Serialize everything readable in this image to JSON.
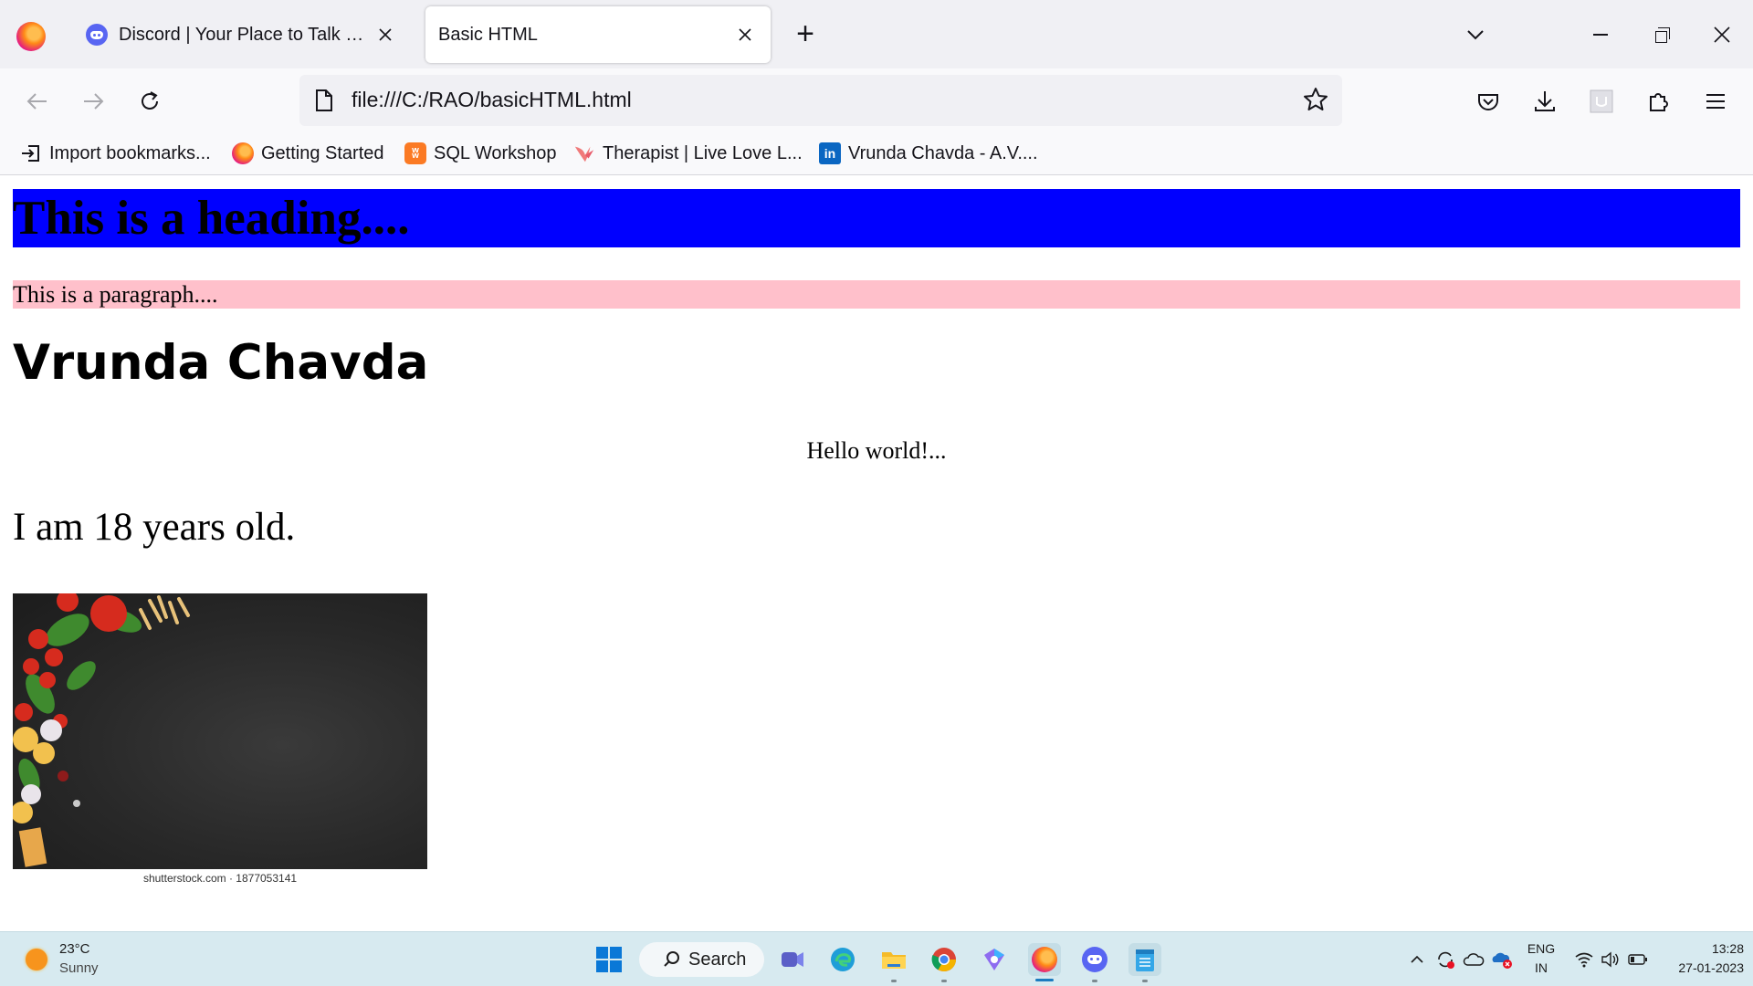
{
  "browser": {
    "tabs": [
      {
        "title": "Discord | Your Place to Talk and Hang Out",
        "active": false
      },
      {
        "title": "Basic HTML",
        "active": true
      }
    ],
    "url": "file:///C:/RAO/basicHTML.html"
  },
  "bookmarks": [
    {
      "label": "Import bookmarks...",
      "icon": "import-icon"
    },
    {
      "label": "Getting Started",
      "icon": "firefox-icon"
    },
    {
      "label": "SQL Workshop",
      "icon": "xampp-icon"
    },
    {
      "label": "Therapist | Live Love L...",
      "icon": "bird-icon"
    },
    {
      "label": "Vrunda Chavda - A.V....",
      "icon": "linkedin-icon"
    }
  ],
  "page": {
    "heading": "This is a heading....",
    "heading_bg": "#0000ff",
    "paragraph": "This is a paragraph....",
    "paragraph_bg": "#ffc0cb",
    "name": "Vrunda Chavda",
    "hello": "Hello world!...",
    "age_text": "I am 18 years old.",
    "image_caption": "shutterstock.com · 1877053141"
  },
  "taskbar": {
    "weather": {
      "temp": "23°C",
      "desc": "Sunny"
    },
    "search_label": "Search",
    "lang": {
      "line1": "ENG",
      "line2": "IN"
    },
    "time": "13:28",
    "date": "27-01-2023"
  }
}
